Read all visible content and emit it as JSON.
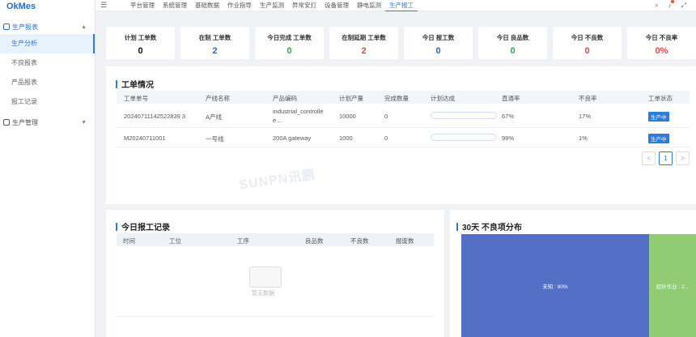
{
  "app": {
    "logo": "OkMes"
  },
  "sidebar": {
    "group1": "生产报表",
    "items": [
      "生产分析",
      "不良报表",
      "产品报表",
      "报工记录"
    ],
    "group2": "生产管理"
  },
  "topnav": {
    "items": [
      "平台管理",
      "系统管理",
      "基础数据",
      "作业指导",
      "生产监测",
      "异常安灯",
      "设备管理",
      "静电监测",
      "生产报工"
    ],
    "active_index": 8
  },
  "stats": [
    {
      "label": "计划 工单数",
      "value": "0",
      "color": "#111111"
    },
    {
      "label": "在制 工单数",
      "value": "2",
      "color": "#2a63c5"
    },
    {
      "label": "今日完成 工单数",
      "value": "0",
      "color": "#2ea84a"
    },
    {
      "label": "在制延期 工单数",
      "value": "2",
      "color": "#e24a4a"
    },
    {
      "label": "今日 报工数",
      "value": "0",
      "color": "#2a63c5"
    },
    {
      "label": "今日 良品数",
      "value": "0",
      "color": "#2ea84a"
    },
    {
      "label": "今日 不良数",
      "value": "0",
      "color": "#e24a4a"
    },
    {
      "label": "今日 不良率",
      "value": "0%",
      "color": "#e24a4a"
    }
  ],
  "orders": {
    "title": "工单情况",
    "columns": [
      "工单单号",
      "产线名称",
      "产品编码",
      "计划产量",
      "完成数量",
      "计划达成",
      "直通率",
      "不良率",
      "工单状态"
    ],
    "rows": [
      {
        "no": "20240711142522839 3",
        "line": "A产线",
        "code": "industrial_controlle",
        "code2": "e...",
        "plan": "10000",
        "done": "0",
        "fpy": "67%",
        "defect": "17%",
        "status": "生产中",
        "progress": 0
      },
      {
        "no": "M20240711001",
        "line": "一号线",
        "code": "200A gateway",
        "code2": "",
        "plan": "1000",
        "done": "0",
        "fpy": "99%",
        "defect": "1%",
        "status": "生产中",
        "progress": 0
      }
    ],
    "pager": {
      "prev": "<",
      "page": "1",
      "next": ">"
    }
  },
  "records": {
    "title": "今日报工记录",
    "columns": [
      "时间",
      "工位",
      "工序",
      "良品数",
      "不良数",
      "报废数"
    ],
    "empty": "暂无数据"
  },
  "defects": {
    "title": "30天 不良项分布",
    "chart_data": {
      "type": "treemap",
      "items": [
        {
          "label": "未知 : 80%",
          "value": 80,
          "color": "#5470c6"
        },
        {
          "label": "控针作业 : 2...",
          "value": 20,
          "color": "#91cc75"
        }
      ]
    }
  },
  "watermark": "SUNPN讯鹏"
}
